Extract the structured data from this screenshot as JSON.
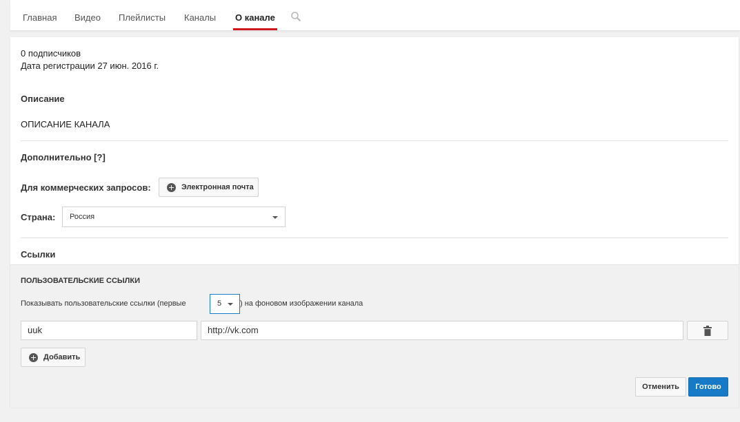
{
  "tabs": [
    {
      "label": "Главная"
    },
    {
      "label": "Видео"
    },
    {
      "label": "Плейлисты"
    },
    {
      "label": "Каналы"
    },
    {
      "label": "О канале"
    }
  ],
  "active_tab": "О канале",
  "stats": {
    "subscribers": "0 подписчиков",
    "registration": "Дата регистрации 27 июн. 2016 г."
  },
  "description": {
    "heading": "Описание",
    "text": "ОПИСАНИЕ КАНАЛА"
  },
  "additional": {
    "heading": "Дополнительно [?]",
    "business_label": "Для коммерческих запросов:",
    "email_button": "Электронная почта",
    "country_label": "Страна:",
    "country_value": "Россия"
  },
  "links": {
    "heading": "Ссылки",
    "custom_heading": "ПОЛЬЗОВАТЕЛЬСКИЕ ССЫЛКИ",
    "show_prefix": "Показывать пользовательские ссылки (первые",
    "show_count": "5",
    "show_suffix": ") на фоновом изображении канала",
    "items": [
      {
        "title": "uuk",
        "url": "http://vk.com"
      }
    ],
    "add_button": "Добавить"
  },
  "actions": {
    "cancel": "Отменить",
    "done": "Готово"
  },
  "colors": {
    "active_tab_underline": "#cc181e",
    "primary_button": "#167ac6"
  }
}
